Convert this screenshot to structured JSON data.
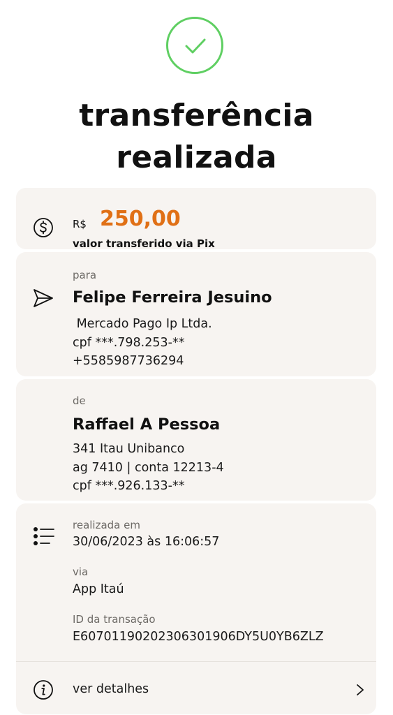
{
  "status": {
    "title_line1": "transferência",
    "title_line2": "realizada",
    "success_color": "#5fcf62"
  },
  "amount": {
    "currency": "R$",
    "value": "250,00",
    "caption": "valor transferido via Pix",
    "value_color": "#e07016",
    "icon": "dollar-circle-icon"
  },
  "recipient": {
    "label": "para",
    "name": "Felipe Ferreira Jesuino",
    "bank": " Mercado Pago Ip Ltda.",
    "cpf": "cpf ***.798.253-**",
    "phone": "+5585987736294",
    "icon": "send-icon"
  },
  "sender": {
    "label": "de",
    "name": "Raffael A Pessoa",
    "bank": "341 Itau Unibanco",
    "account": "ag 7410 | conta 12213-4",
    "cpf": "cpf ***.926.133-**"
  },
  "info": {
    "icon": "list-icon",
    "date_label": "realizada em",
    "date_value": "30/06/2023 às 16:06:57",
    "via_label": "via",
    "via_value": "App Itaú",
    "id_label": "ID da transação",
    "id_value": "E60701190202306301906DY5U0YB6ZLZ"
  },
  "details": {
    "label": "ver detalhes",
    "icon": "info-icon",
    "chevron": "chevron-right-icon"
  }
}
